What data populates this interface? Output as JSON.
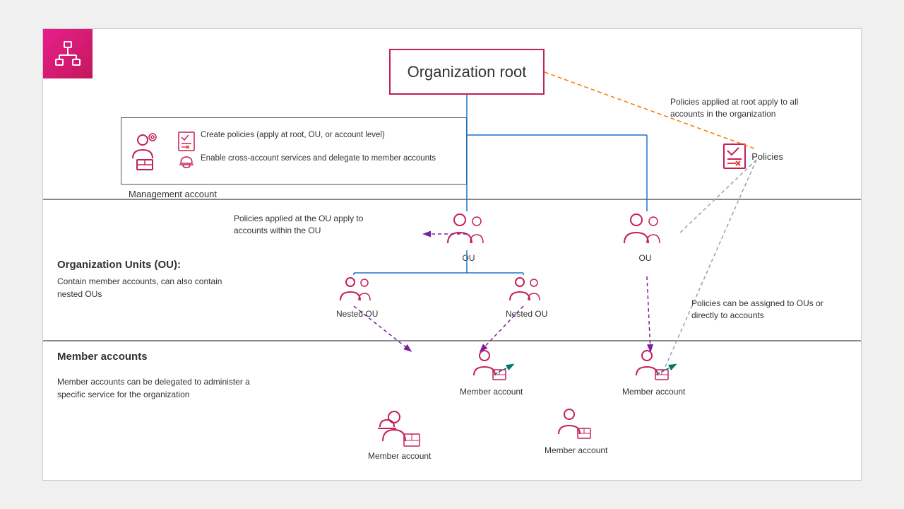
{
  "logo": {
    "alt": "AWS Organizations icon"
  },
  "orgRoot": {
    "label": "Organization root"
  },
  "mgmtAccount": {
    "label": "Management account",
    "feature1": "Create policies (apply at root, OU, or account level)",
    "feature2": "Enable cross-account services and delegate to member accounts"
  },
  "policies": {
    "label": "Policies"
  },
  "ouSection": {
    "title": "Organization Units (OU):",
    "desc": "Contain member accounts, can also contain nested OUs",
    "annotation": "Policies applied at the OU apply to accounts within the OU"
  },
  "ou1": {
    "label": "OU"
  },
  "ou2": {
    "label": "OU"
  },
  "nestedOU1": {
    "label": "Nested OU"
  },
  "nestedOU2": {
    "label": "Nested OU"
  },
  "memberSection": {
    "title": "Member accounts",
    "desc": "Member accounts can be delegated to administer a specific service for the organization"
  },
  "memberAccount1": {
    "label": "Member account"
  },
  "memberAccount2": {
    "label": "Member account"
  },
  "memberAccount3": {
    "label": "Member account"
  },
  "memberAccount4": {
    "label": "Member account"
  },
  "rootAnnotation": "Policies applied at root apply to all accounts in the organization",
  "ouAnnotation": "Policies applied at the OU apply to accounts within the OU",
  "policyAssignAnnotation": "Policies can be assigned to OUs or directly to accounts"
}
